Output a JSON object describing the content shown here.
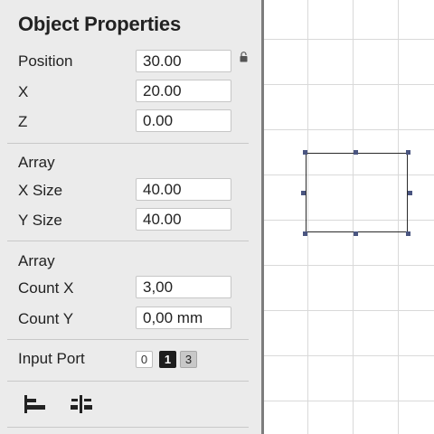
{
  "panel": {
    "title": "Object Properties",
    "position": {
      "label": "Position",
      "value": "30.00"
    },
    "x": {
      "label": "X",
      "value": "20.00"
    },
    "z": {
      "label": "Z",
      "value": "0.00"
    },
    "array1": {
      "heading": "Array",
      "x_size": {
        "label": "X Size",
        "value": "40.00"
      },
      "y_size": {
        "label": "Y Size",
        "value": "40.00"
      }
    },
    "array2": {
      "heading": "Array",
      "count_x": {
        "label": "Count X",
        "value": "3,00"
      },
      "count_y": {
        "label": "Count Y",
        "value": "0,00 mm"
      }
    },
    "input_port": {
      "label": "Input Port",
      "options": [
        "0",
        "1",
        "3"
      ],
      "selected": "1"
    },
    "tools": [
      "align-left-icon",
      "distribute-icon"
    ],
    "icons": [
      "lock-icon"
    ]
  },
  "canvas": {
    "grid": true,
    "shape": "rectangle",
    "colors": {
      "handle": "#4a5580",
      "stroke": "#2a2a2a",
      "grid": "#d9d9d9"
    }
  }
}
